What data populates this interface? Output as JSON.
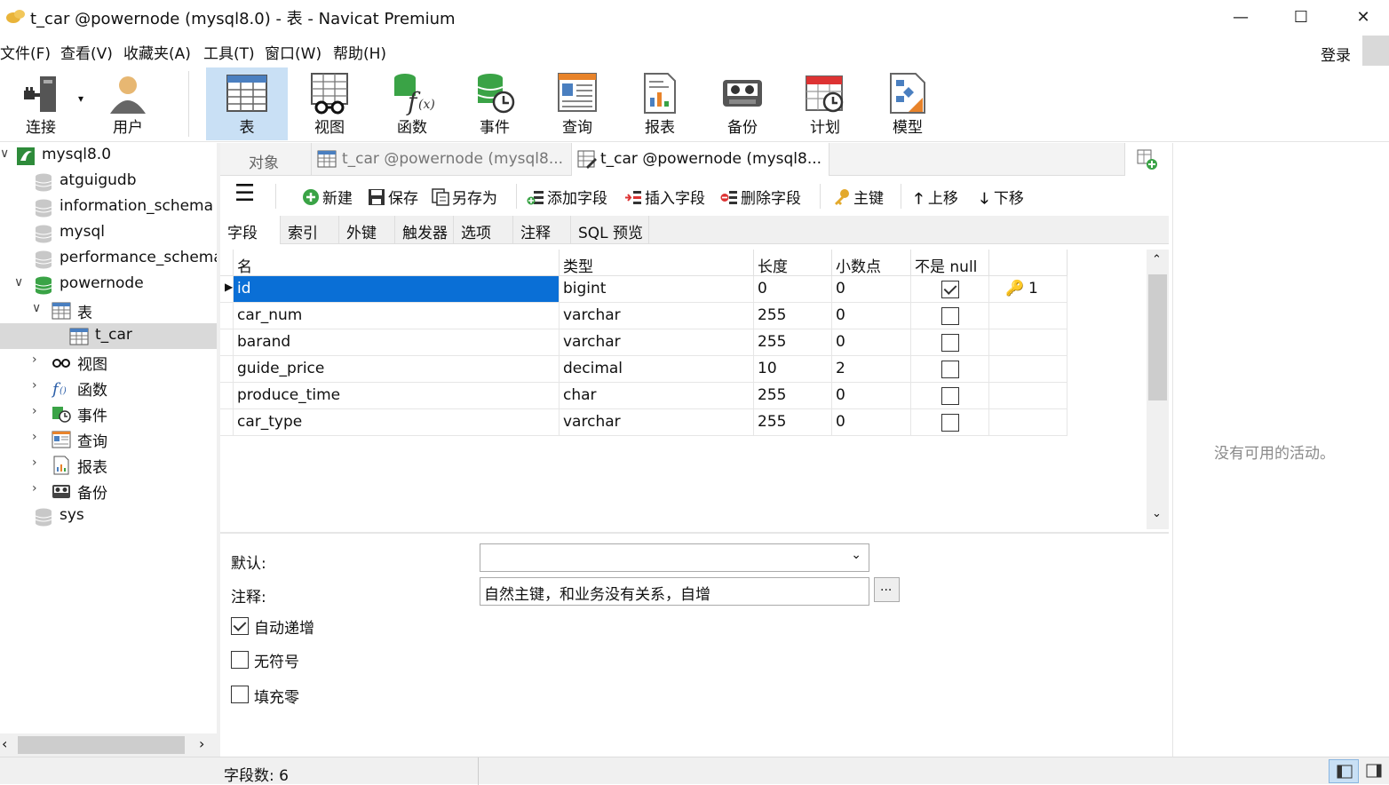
{
  "window": {
    "title": "t_car @powernode (mysql8.0) - 表 - Navicat Premium",
    "controls": {
      "minimize": "—",
      "maximize": "☐",
      "close": "✕"
    }
  },
  "menu": {
    "items": [
      "文件(F)",
      "查看(V)",
      "收藏夹(A)",
      "工具(T)",
      "窗口(W)",
      "帮助(H)"
    ],
    "login": "登录"
  },
  "toolbar": {
    "connect": "连接",
    "user": "用户",
    "table": "表",
    "view": "视图",
    "function": "函数",
    "event": "事件",
    "query": "查询",
    "report": "报表",
    "backup": "备份",
    "schedule": "计划",
    "model": "模型"
  },
  "tree": {
    "connection": "mysql8.0",
    "databases": [
      "atguigudb",
      "information_schema",
      "mysql",
      "performance_schema",
      "powernode",
      "sys"
    ],
    "tables_folder": "表",
    "table": "t_car",
    "folders": [
      "视图",
      "函数",
      "事件",
      "查询",
      "报表",
      "备份"
    ]
  },
  "tabs": {
    "objects": "对象",
    "tab1": "t_car @powernode (mysql8...",
    "tab2": "t_car @powernode (mysql8..."
  },
  "actions": {
    "new": "新建",
    "save": "保存",
    "save_as": "另存为",
    "add_field": "添加字段",
    "insert_field": "插入字段",
    "delete_field": "删除字段",
    "primary_key": "主键",
    "move_up": "上移",
    "move_down": "下移"
  },
  "subtabs": [
    "字段",
    "索引",
    "外键",
    "触发器",
    "选项",
    "注释",
    "SQL 预览"
  ],
  "grid": {
    "headers": [
      "名",
      "类型",
      "长度",
      "小数点",
      "不是 null",
      ""
    ],
    "rows": [
      {
        "name": "id",
        "type": "bigint",
        "length": "0",
        "decimals": "0",
        "not_null": true,
        "key": "1"
      },
      {
        "name": "car_num",
        "type": "varchar",
        "length": "255",
        "decimals": "0",
        "not_null": false,
        "key": ""
      },
      {
        "name": "barand",
        "type": "varchar",
        "length": "255",
        "decimals": "0",
        "not_null": false,
        "key": ""
      },
      {
        "name": "guide_price",
        "type": "decimal",
        "length": "10",
        "decimals": "2",
        "not_null": false,
        "key": ""
      },
      {
        "name": "produce_time",
        "type": "char",
        "length": "255",
        "decimals": "0",
        "not_null": false,
        "key": ""
      },
      {
        "name": "car_type",
        "type": "varchar",
        "length": "255",
        "decimals": "0",
        "not_null": false,
        "key": ""
      }
    ]
  },
  "props": {
    "default_label": "默认:",
    "default_value": "",
    "comment_label": "注释:",
    "comment_value": "自然主键，和业务没有关系，自增",
    "ellipsis": "...",
    "auto_increment": "自动递增",
    "unsigned": "无符号",
    "zerofill": "填充零",
    "auto_increment_checked": true,
    "unsigned_checked": false,
    "zerofill_checked": false
  },
  "right_panel": {
    "message": "没有可用的活动。"
  },
  "status": {
    "field_count": "字段数: 6"
  },
  "colors": {
    "selection": "#0a6fd6",
    "toolbar_active": "#c9e0f5",
    "db_green": "#3aa346"
  }
}
